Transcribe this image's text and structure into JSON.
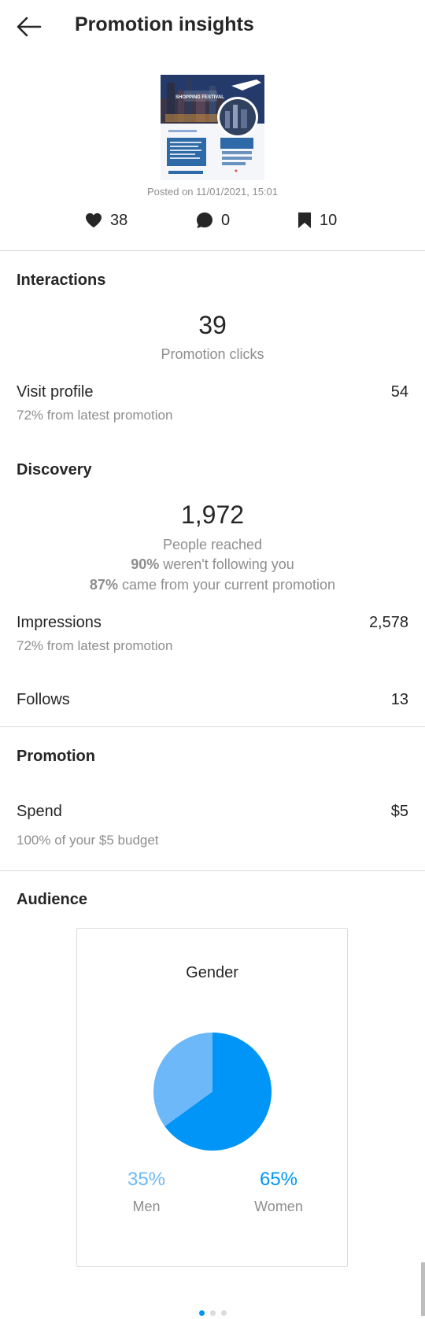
{
  "header": {
    "title": "Promotion insights",
    "back_icon": "arrow-left-icon"
  },
  "post": {
    "thumbnail_text": "SHOPPING FESTIVAL",
    "posted": "Posted on 11/01/2021, 15:01",
    "likes": "38",
    "comments": "0",
    "saves": "10"
  },
  "interactions": {
    "title": "Interactions",
    "clicks": "39",
    "clicks_label": "Promotion clicks",
    "visit_profile_label": "Visit profile",
    "visit_profile_value": "54",
    "visit_profile_note": "72% from latest promotion"
  },
  "discovery": {
    "title": "Discovery",
    "reached": "1,972",
    "reached_label": "People reached",
    "not_following_pct": "90%",
    "not_following_text": " weren't following you",
    "from_promo_pct": "87%",
    "from_promo_text": " came from your current promotion",
    "impressions_label": "Impressions",
    "impressions_value": "2,578",
    "impressions_note": "72% from latest promotion",
    "follows_label": "Follows",
    "follows_value": "13"
  },
  "promotion": {
    "title": "Promotion",
    "spend_label": "Spend",
    "spend_value": "$5",
    "spend_note": "100% of your $5 budget"
  },
  "audience": {
    "title": "Audience",
    "gender_title": "Gender",
    "men_pct": "35%",
    "men_label": "Men",
    "women_pct": "65%",
    "women_label": "Women"
  },
  "chart_data": {
    "type": "pie",
    "title": "Gender",
    "categories": [
      "Men",
      "Women"
    ],
    "values": [
      35,
      65
    ],
    "colors": [
      "#6cb8f8",
      "#0095f6"
    ]
  },
  "pager": {
    "count": 3,
    "active": 0
  },
  "colors": {
    "accent": "#0095f6",
    "accent_light": "#6cb8f8",
    "text": "#262626",
    "secondary": "#8e8e8e",
    "divider": "#dbdbdb"
  }
}
